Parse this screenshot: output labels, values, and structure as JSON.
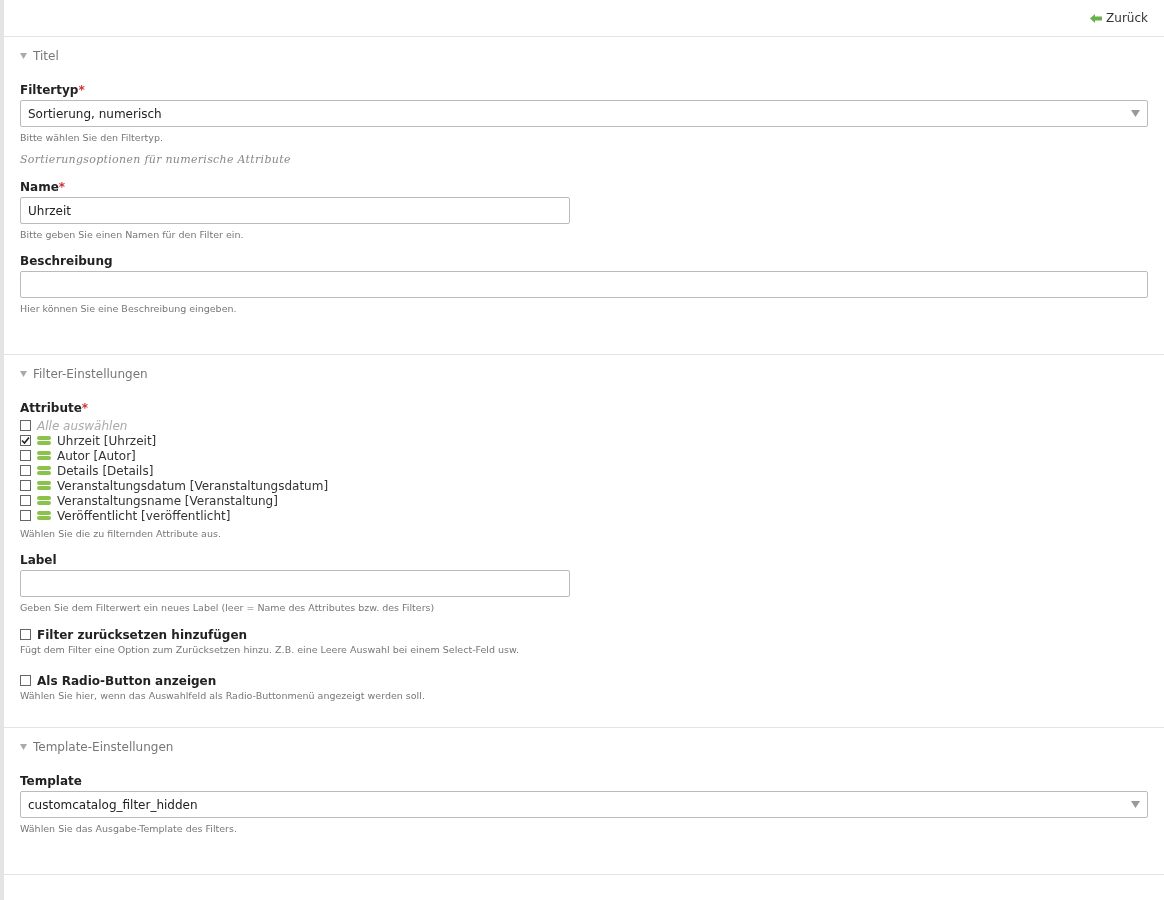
{
  "back_link": {
    "label": "Zurück"
  },
  "sections": [
    {
      "title": "Titel",
      "expanded": true,
      "fields": [
        {
          "kind": "select",
          "label": "Filtertyp",
          "required_mark": "*",
          "value": "Sortierung, numerisch",
          "help": "Bitte wählen Sie den Filtertyp.",
          "note": "Sortierungsoptionen für numerische Attribute"
        },
        {
          "kind": "short-text",
          "label": "Name",
          "required_mark": "*",
          "value": "Uhrzeit",
          "help": "Bitte geben Sie einen Namen für den Filter ein."
        },
        {
          "kind": "text",
          "label": "Beschreibung",
          "help": "Hier können Sie eine Beschreibung eingeben."
        }
      ]
    },
    {
      "title": "Filter-Einstellungen",
      "expanded": true,
      "fields": [
        {
          "kind": "checklist",
          "label": "Attribute",
          "required_mark": "*",
          "select_all": {
            "label": "Alle auswählen",
            "checked": false
          },
          "items": [
            {
              "label": "Uhrzeit [Uhrzeit]",
              "checked": true
            },
            {
              "label": "Autor [Autor]",
              "checked": false
            },
            {
              "label": "Details [Details]",
              "checked": false
            },
            {
              "label": "Veranstaltungsdatum [Veranstaltungsdatum]",
              "checked": false
            },
            {
              "label": "Veranstaltungsname [Veranstaltung]",
              "checked": false
            },
            {
              "label": "Veröffentlicht [veröffentlicht]",
              "checked": false
            }
          ],
          "help": "Wählen Sie die zu filternden Attribute aus."
        },
        {
          "kind": "short-text",
          "label": "Label",
          "help": "Geben Sie dem Filterwert ein neues Label (leer = Name des Attributes bzw. des Filters)"
        },
        {
          "kind": "checkbox",
          "label": "Filter zurücksetzen hinzufügen",
          "checked": false,
          "help": "Fügt dem Filter eine Option zum Zurücksetzen hinzu. Z.B. eine Leere Auswahl bei einem Select-Feld usw."
        },
        {
          "kind": "checkbox",
          "label": "Als Radio-Button anzeigen",
          "checked": false,
          "help": "Wählen Sie hier, wenn das Auswahlfeld als Radio-Buttonmenü angezeigt werden soll."
        }
      ]
    },
    {
      "title": "Template-Einstellungen",
      "expanded": true,
      "fields": [
        {
          "kind": "select",
          "label": "Template",
          "value": "customcatalog_filter_hidden",
          "help": "Wählen Sie das Ausgabe-Template des Filters."
        }
      ]
    }
  ]
}
